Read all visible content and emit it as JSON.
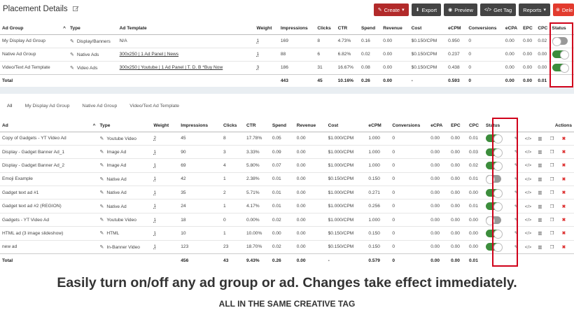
{
  "header": {
    "title": "Placement Details",
    "buttons": {
      "create": "Create",
      "export": "Export",
      "preview": "Preview",
      "get_tag": "Get Tag",
      "reports": "Reports",
      "delete": "Dele"
    }
  },
  "groups_table": {
    "headers": {
      "ad_group": "Ad Group",
      "type": "Type",
      "ad_template": "Ad Template",
      "weight": "Weight",
      "impressions": "Impressions",
      "clicks": "Clicks",
      "ctr": "CTR",
      "spend": "Spend",
      "revenue": "Revenue",
      "cost": "Cost",
      "ecpm": "eCPM",
      "conversions": "Conversions",
      "ecpa": "eCPA",
      "epc": "EPC",
      "cpc": "CPC",
      "status": "Status"
    },
    "rows": [
      {
        "name": "My Display Ad Group",
        "type": "Display/Banners",
        "template": "N/A",
        "weight": "1",
        "impressions": "169",
        "clicks": "8",
        "ctr": "4.73%",
        "spend": "0.16",
        "revenue": "0.00",
        "cost": "$0.150/CPM",
        "ecpm": "0.950",
        "conversions": "0",
        "ecpa": "0.00",
        "epc": "0.00",
        "cpc": "0.02",
        "status": "off"
      },
      {
        "name": "Native Ad Group",
        "type": "Native Ads",
        "template": "300x250 | 1 Ad Panel | News",
        "weight": "1",
        "impressions": "88",
        "clicks": "6",
        "ctr": "6.82%",
        "spend": "0.02",
        "revenue": "0.00",
        "cost": "$0.150/CPM",
        "ecpm": "0.237",
        "conversions": "0",
        "ecpa": "0.00",
        "epc": "0.00",
        "cpc": "0.00",
        "status": "on"
      },
      {
        "name": "Video/Text Ad Template",
        "type": "Video Ads",
        "template": "300x250 | Youtube | 1 Ad Panel | T. D. B *Buy Now",
        "weight": "3",
        "impressions": "186",
        "clicks": "31",
        "ctr": "16.67%",
        "spend": "0.08",
        "revenue": "0.00",
        "cost": "$0.150/CPM",
        "ecpm": "0.438",
        "conversions": "0",
        "ecpa": "0.00",
        "epc": "0.00",
        "cpc": "0.00",
        "status": "on"
      }
    ],
    "total": {
      "label": "Total",
      "impressions": "443",
      "clicks": "45",
      "ctr": "10.16%",
      "spend": "0.26",
      "revenue": "0.00",
      "cost": "-",
      "ecpm": "0.593",
      "conversions": "0",
      "ecpa": "0.00",
      "epc": "0.00",
      "cpc": "0.01"
    }
  },
  "tabs": [
    "All",
    "My Display Ad Group",
    "Native Ad Group",
    "Video/Text Ad Template"
  ],
  "ads_table": {
    "headers": {
      "ad": "Ad",
      "type": "Type",
      "weight": "Weight",
      "impressions": "Impressions",
      "clicks": "Clicks",
      "ctr": "CTR",
      "spend": "Spend",
      "revenue": "Revenue",
      "cost": "Cost",
      "ecpm": "eCPM",
      "conversions": "Conversions",
      "ecpa": "eCPA",
      "epc": "EPC",
      "cpc": "CPC",
      "status": "Status",
      "actions": "Actions"
    },
    "rows": [
      {
        "name": "Copy of Gadgets - YT Video Ad",
        "type": "Youtube Video",
        "weight": "2",
        "impressions": "45",
        "clicks": "8",
        "ctr": "17.78%",
        "spend": "0.05",
        "revenue": "0.00",
        "cost": "$1.000/CPM",
        "ecpm": "1.000",
        "conversions": "0",
        "ecpa": "0.00",
        "epc": "0.00",
        "cpc": "0.01",
        "status": "on"
      },
      {
        "name": "Display - Gadget Banner Ad_1",
        "type": "Image Ad",
        "weight": "1",
        "impressions": "90",
        "clicks": "3",
        "ctr": "3.33%",
        "spend": "0.09",
        "revenue": "0.00",
        "cost": "$1.000/CPM",
        "ecpm": "1.000",
        "conversions": "0",
        "ecpa": "0.00",
        "epc": "0.00",
        "cpc": "0.03",
        "status": "on"
      },
      {
        "name": "Display - Gadget Banner Ad_2",
        "type": "Image Ad",
        "weight": "1",
        "impressions": "69",
        "clicks": "4",
        "ctr": "5.80%",
        "spend": "0.07",
        "revenue": "0.00",
        "cost": "$1.000/CPM",
        "ecpm": "1.000",
        "conversions": "0",
        "ecpa": "0.00",
        "epc": "0.00",
        "cpc": "0.02",
        "status": "on"
      },
      {
        "name": "Emoji Example",
        "type": "Native Ad",
        "weight": "1",
        "impressions": "42",
        "clicks": "1",
        "ctr": "2.38%",
        "spend": "0.01",
        "revenue": "0.00",
        "cost": "$0.150/CPM",
        "ecpm": "0.150",
        "conversions": "0",
        "ecpa": "0.00",
        "epc": "0.00",
        "cpc": "0.01",
        "status": "off"
      },
      {
        "name": "Gadget text ad #1",
        "type": "Native Ad",
        "weight": "1",
        "impressions": "35",
        "clicks": "2",
        "ctr": "5.71%",
        "spend": "0.01",
        "revenue": "0.00",
        "cost": "$1.000/CPM",
        "ecpm": "0.271",
        "conversions": "0",
        "ecpa": "0.00",
        "epc": "0.00",
        "cpc": "0.00",
        "status": "on"
      },
      {
        "name": "Gadget text ad #2 (REGION)",
        "type": "Native Ad",
        "weight": "1",
        "impressions": "24",
        "clicks": "1",
        "ctr": "4.17%",
        "spend": "0.01",
        "revenue": "0.00",
        "cost": "$1.000/CPM",
        "ecpm": "0.256",
        "conversions": "0",
        "ecpa": "0.00",
        "epc": "0.00",
        "cpc": "0.01",
        "status": "on"
      },
      {
        "name": "Gadgets - YT Video Ad",
        "type": "Youtube Video",
        "weight": "1",
        "impressions": "18",
        "clicks": "0",
        "ctr": "0.00%",
        "spend": "0.02",
        "revenue": "0.00",
        "cost": "$1.000/CPM",
        "ecpm": "1.000",
        "conversions": "0",
        "ecpa": "0.00",
        "epc": "0.00",
        "cpc": "0.00",
        "status": "off"
      },
      {
        "name": "HTML ad (3 image slideshow)",
        "type": "HTML",
        "weight": "1",
        "impressions": "10",
        "clicks": "1",
        "ctr": "10.00%",
        "spend": "0.00",
        "revenue": "0.00",
        "cost": "$0.150/CPM",
        "ecpm": "0.150",
        "conversions": "0",
        "ecpa": "0.00",
        "epc": "0.00",
        "cpc": "0.00",
        "status": "on"
      },
      {
        "name": "new ad",
        "type": "In-Banner Video",
        "weight": "1",
        "impressions": "123",
        "clicks": "23",
        "ctr": "18.70%",
        "spend": "0.02",
        "revenue": "0.00",
        "cost": "$0.150/CPM",
        "ecpm": "0.150",
        "conversions": "0",
        "ecpa": "0.00",
        "epc": "0.00",
        "cpc": "0.00",
        "status": "on"
      }
    ],
    "total": {
      "label": "Total",
      "impressions": "456",
      "clicks": "43",
      "ctr": "9.43%",
      "spend": "0.26",
      "revenue": "0.00",
      "cost": "-",
      "ecpm": "0.579",
      "conversions": "0",
      "ecpa": "0.00",
      "epc": "0.00",
      "cpc": "0.01"
    }
  },
  "caption": "Easily turn on/off any ad group or ad. Changes take effect immediately.",
  "subcaption": "ALL IN THE SAME CREATIVE TAG",
  "colors": {
    "toggle_on": "#3c8d3c",
    "toggle_off": "#999999",
    "highlight": "#d0021b",
    "create_button": "#b22a2a",
    "delete_button": "#e23b2e"
  }
}
